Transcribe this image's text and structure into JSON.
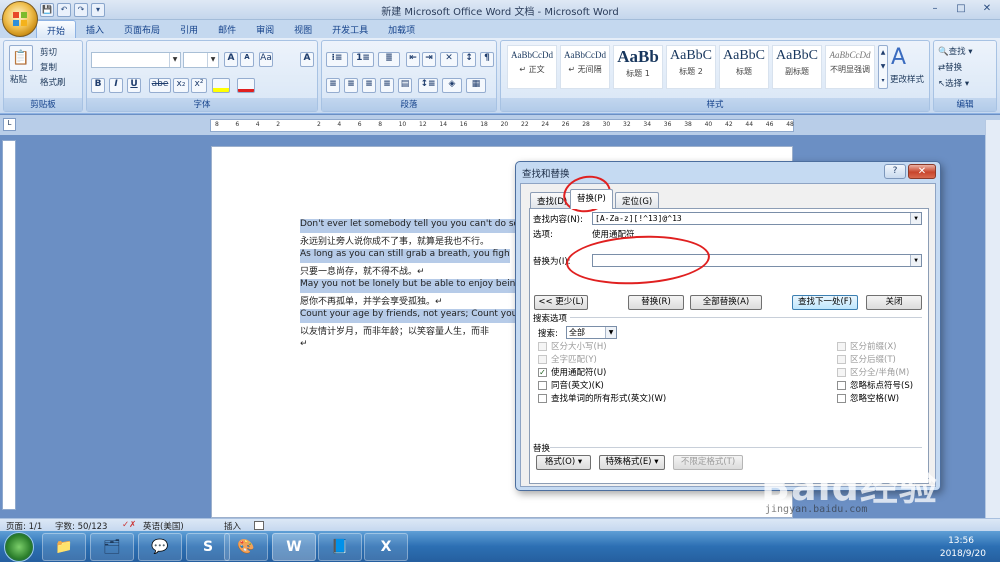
{
  "window": {
    "title": "新建 Microsoft Office Word 文档 - Microsoft Word",
    "controls": [
      "–",
      "□",
      "✕"
    ]
  },
  "quick_access": [
    "💾",
    "↶",
    "↷",
    "▾"
  ],
  "ribbon_tabs": [
    "开始",
    "插入",
    "页面布局",
    "引用",
    "邮件",
    "审阅",
    "视图",
    "开发工具",
    "加载项"
  ],
  "ribbon": {
    "clipboard": {
      "group": "剪贴板",
      "paste": "粘贴",
      "cut": "剪切",
      "copy": "复制",
      "format_painter": "格式刷"
    },
    "font": {
      "group": "字体",
      "family": "",
      "size": "",
      "bold": "B",
      "italic": "I",
      "underline": "U",
      "strike": "abe",
      "sub": "x₂",
      "sup": "x²",
      "aa": "Aa",
      "grow": "A",
      "shrink": "A",
      "clear": "A"
    },
    "paragraph": {
      "group": "段落"
    },
    "styles": {
      "group": "样式",
      "items": [
        {
          "preview": "AaBbCcDd",
          "name": "↵ 正文"
        },
        {
          "preview": "AaBbCcDd",
          "name": "↵ 无间隔"
        },
        {
          "preview": "AaBb",
          "name": "标题 1"
        },
        {
          "preview": "AaBbC",
          "name": "标题 2"
        },
        {
          "preview": "AaBbC",
          "name": "标题"
        },
        {
          "preview": "AaBbC",
          "name": "副标题"
        },
        {
          "preview": "AaBbCcDd",
          "name": "不明显强调"
        }
      ],
      "change_styles": "更改样式"
    },
    "editing": {
      "group": "编辑",
      "find": "查找 ▾",
      "replace": "替换",
      "select": "选择 ▾"
    }
  },
  "ruler": {
    "ticks": [
      "8",
      "6",
      "4",
      "2",
      "",
      "2",
      "4",
      "6",
      "8",
      "10",
      "12",
      "14",
      "16",
      "18",
      "20",
      "22",
      "24",
      "26",
      "28",
      "30",
      "32",
      "34",
      "36",
      "38",
      "40",
      "42",
      "44",
      "46",
      "48"
    ]
  },
  "document": {
    "lines": [
      {
        "text": "Don't ever let somebody tell you you can't do somet",
        "hl": true
      },
      {
        "text": "永远别让旁人说你成不了事，就算是我也不行。",
        "hl": false
      },
      {
        "text": "As long as you can still grab a breath, you fight.  ↵",
        "hl": true
      },
      {
        "text": "只要一息尚存，就不得不战。↵",
        "hl": false
      },
      {
        "text": "May you not be lonely but be able to enjoy being alo",
        "hl": true
      },
      {
        "text": "愿你不再孤单，并学会享受孤独。↵",
        "hl": false
      },
      {
        "text": "Count your age by friends, not years; Count your life",
        "hl": true
      },
      {
        "text": "以友情计岁月，而非年龄；以笑容量人生，而非",
        "hl": false
      },
      {
        "text": "↵",
        "hl": false
      }
    ]
  },
  "dialog": {
    "title": "查找和替换",
    "help": "?",
    "close": "✕",
    "tabs": [
      "查找(D)",
      "替换(P)",
      "定位(G)"
    ],
    "find_label": "查找内容(N):",
    "find_value": "[A-Za-z][!^13]@^13",
    "options_label": "选项:",
    "options_value": "使用通配符",
    "replace_label": "替换为(I):",
    "replace_value": "",
    "buttons": {
      "less": "<< 更少(L)",
      "replace": "替换(R)",
      "replace_all": "全部替换(A)",
      "find_next": "查找下一处(F)",
      "close": "关闭"
    },
    "search_options_title": "搜索选项",
    "search_label": "搜索:",
    "search_value": "全部",
    "left_options": [
      {
        "label": "区分大小写(H)",
        "checked": false,
        "disabled": true
      },
      {
        "label": "全字匹配(Y)",
        "checked": false,
        "disabled": true
      },
      {
        "label": "使用通配符(U)",
        "checked": true,
        "disabled": false
      },
      {
        "label": "同音(英文)(K)",
        "checked": false,
        "disabled": false
      },
      {
        "label": "查找单词的所有形式(英文)(W)",
        "checked": false,
        "disabled": false
      }
    ],
    "right_options": [
      {
        "label": "区分前缀(X)",
        "checked": false,
        "disabled": true
      },
      {
        "label": "区分后缀(T)",
        "checked": false,
        "disabled": true
      },
      {
        "label": "区分全/半角(M)",
        "checked": false,
        "disabled": true
      },
      {
        "label": "忽略标点符号(S)",
        "checked": false,
        "disabled": false
      },
      {
        "label": "忽略空格(W)",
        "checked": false,
        "disabled": false
      }
    ],
    "replace_section": "替换",
    "format_btn": "格式(O) ▾",
    "special_btn": "特殊格式(E) ▾",
    "no_format_btn": "不限定格式(T)"
  },
  "statusbar": {
    "page": "页面: 1/1",
    "words": "字数: 50/123",
    "lang": "英语(美国)",
    "mode": "插入"
  },
  "taskbar": {
    "apps": [
      "📁",
      "🗂",
      "💬",
      "S",
      "🎨",
      "W",
      "📘",
      "X"
    ],
    "time": "13:56",
    "date": "2018/9/20"
  },
  "watermark": {
    "brand": "Baid经验",
    "url": "jingyan.baidu.com"
  },
  "colors": {
    "accent": "#15428b",
    "annotation": "#e02020"
  }
}
